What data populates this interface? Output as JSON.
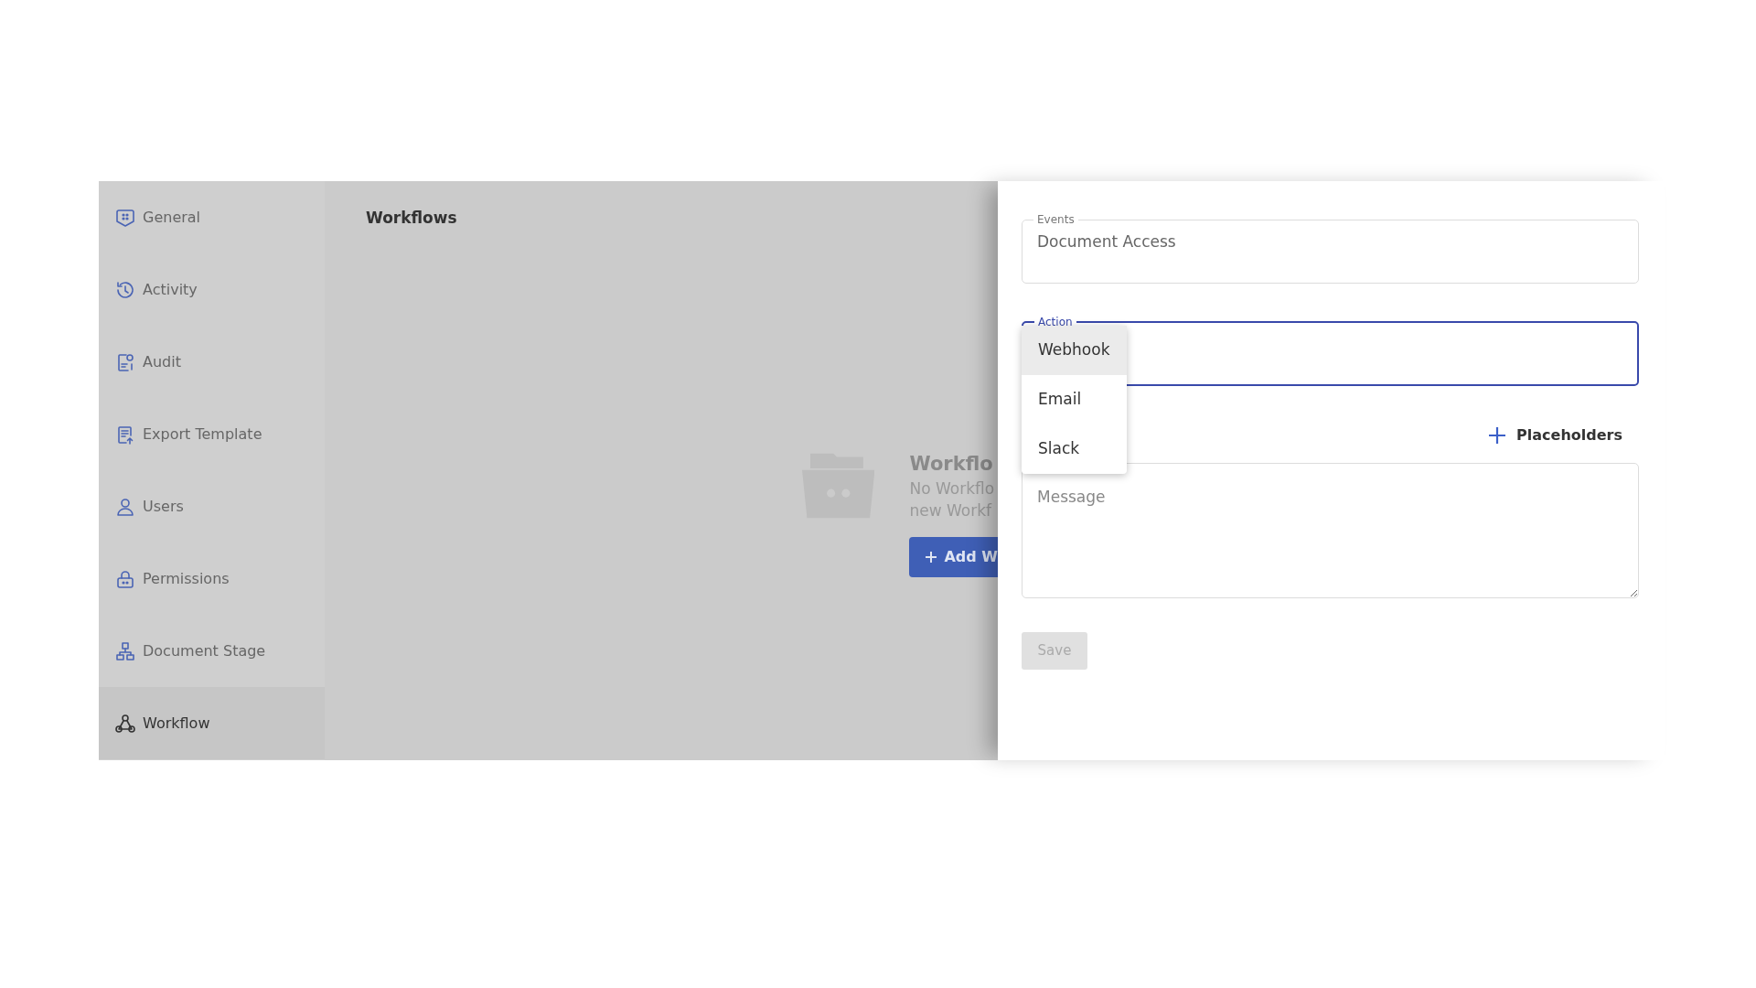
{
  "sidebar": {
    "items": [
      {
        "label": "General",
        "selected": false
      },
      {
        "label": "Activity",
        "selected": false
      },
      {
        "label": "Audit",
        "selected": false
      },
      {
        "label": "Export Template",
        "selected": false
      },
      {
        "label": "Users",
        "selected": false
      },
      {
        "label": "Permissions",
        "selected": false
      },
      {
        "label": "Document Stage",
        "selected": false
      },
      {
        "label": "Workflow",
        "selected": true
      }
    ]
  },
  "main": {
    "title": "Workflows",
    "empty_state": {
      "title": "Workflo",
      "text_lines": [
        "No Workflo",
        "new Workf"
      ],
      "button": "Add W"
    }
  },
  "drawer": {
    "events": {
      "label": "Events",
      "value": "Document Access"
    },
    "action": {
      "label": "Action",
      "focused": true,
      "menu": [
        {
          "label": "Webhook",
          "selected": true
        },
        {
          "label": "Email",
          "selected": false
        },
        {
          "label": "Slack",
          "selected": false
        }
      ]
    },
    "placeholders_button": "Placeholders",
    "message": {
      "placeholder": "Message"
    },
    "save": {
      "label": "Save",
      "disabled": true
    }
  }
}
